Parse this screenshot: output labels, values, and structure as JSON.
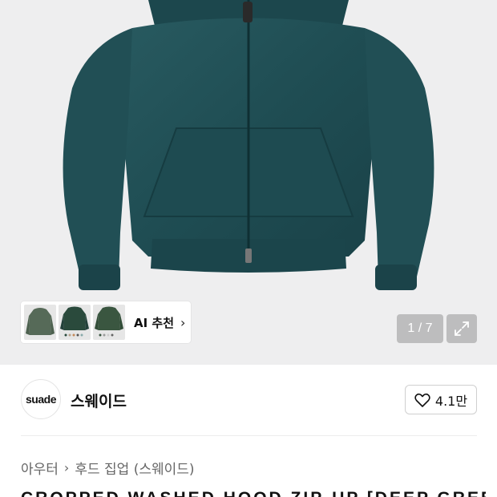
{
  "product_image": {
    "alt_icon": "hoodie-product-image"
  },
  "ai_recommend": {
    "label": "AI 추천",
    "chevron": "›"
  },
  "pager": {
    "text": "1 / 7"
  },
  "brand": {
    "logo_text": "suade",
    "name": "스웨이드"
  },
  "like": {
    "count": "4.1만"
  },
  "breadcrumb": {
    "items": [
      "아우터",
      "후드 집업 (스웨이드)"
    ],
    "separator": "›"
  },
  "product_title": "CROPPED WASHED HOOD ZIP-UP [DEEP GREEN]",
  "colors": {
    "hoodie": "#1f4f55",
    "hero_bg": "#eeeeef"
  }
}
